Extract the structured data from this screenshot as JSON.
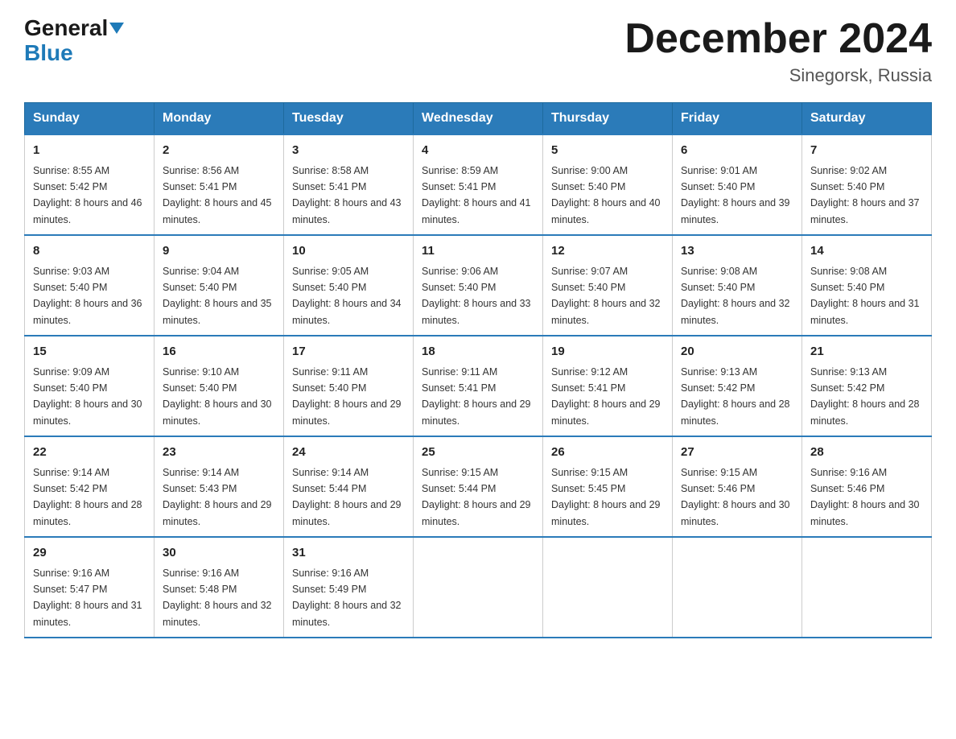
{
  "logo": {
    "general": "General",
    "blue": "Blue"
  },
  "title": "December 2024",
  "location": "Sinegorsk, Russia",
  "header": {
    "days": [
      "Sunday",
      "Monday",
      "Tuesday",
      "Wednesday",
      "Thursday",
      "Friday",
      "Saturday"
    ]
  },
  "weeks": [
    [
      {
        "day": "1",
        "sunrise": "8:55 AM",
        "sunset": "5:42 PM",
        "daylight": "8 hours and 46 minutes."
      },
      {
        "day": "2",
        "sunrise": "8:56 AM",
        "sunset": "5:41 PM",
        "daylight": "8 hours and 45 minutes."
      },
      {
        "day": "3",
        "sunrise": "8:58 AM",
        "sunset": "5:41 PM",
        "daylight": "8 hours and 43 minutes."
      },
      {
        "day": "4",
        "sunrise": "8:59 AM",
        "sunset": "5:41 PM",
        "daylight": "8 hours and 41 minutes."
      },
      {
        "day": "5",
        "sunrise": "9:00 AM",
        "sunset": "5:40 PM",
        "daylight": "8 hours and 40 minutes."
      },
      {
        "day": "6",
        "sunrise": "9:01 AM",
        "sunset": "5:40 PM",
        "daylight": "8 hours and 39 minutes."
      },
      {
        "day": "7",
        "sunrise": "9:02 AM",
        "sunset": "5:40 PM",
        "daylight": "8 hours and 37 minutes."
      }
    ],
    [
      {
        "day": "8",
        "sunrise": "9:03 AM",
        "sunset": "5:40 PM",
        "daylight": "8 hours and 36 minutes."
      },
      {
        "day": "9",
        "sunrise": "9:04 AM",
        "sunset": "5:40 PM",
        "daylight": "8 hours and 35 minutes."
      },
      {
        "day": "10",
        "sunrise": "9:05 AM",
        "sunset": "5:40 PM",
        "daylight": "8 hours and 34 minutes."
      },
      {
        "day": "11",
        "sunrise": "9:06 AM",
        "sunset": "5:40 PM",
        "daylight": "8 hours and 33 minutes."
      },
      {
        "day": "12",
        "sunrise": "9:07 AM",
        "sunset": "5:40 PM",
        "daylight": "8 hours and 32 minutes."
      },
      {
        "day": "13",
        "sunrise": "9:08 AM",
        "sunset": "5:40 PM",
        "daylight": "8 hours and 32 minutes."
      },
      {
        "day": "14",
        "sunrise": "9:08 AM",
        "sunset": "5:40 PM",
        "daylight": "8 hours and 31 minutes."
      }
    ],
    [
      {
        "day": "15",
        "sunrise": "9:09 AM",
        "sunset": "5:40 PM",
        "daylight": "8 hours and 30 minutes."
      },
      {
        "day": "16",
        "sunrise": "9:10 AM",
        "sunset": "5:40 PM",
        "daylight": "8 hours and 30 minutes."
      },
      {
        "day": "17",
        "sunrise": "9:11 AM",
        "sunset": "5:40 PM",
        "daylight": "8 hours and 29 minutes."
      },
      {
        "day": "18",
        "sunrise": "9:11 AM",
        "sunset": "5:41 PM",
        "daylight": "8 hours and 29 minutes."
      },
      {
        "day": "19",
        "sunrise": "9:12 AM",
        "sunset": "5:41 PM",
        "daylight": "8 hours and 29 minutes."
      },
      {
        "day": "20",
        "sunrise": "9:13 AM",
        "sunset": "5:42 PM",
        "daylight": "8 hours and 28 minutes."
      },
      {
        "day": "21",
        "sunrise": "9:13 AM",
        "sunset": "5:42 PM",
        "daylight": "8 hours and 28 minutes."
      }
    ],
    [
      {
        "day": "22",
        "sunrise": "9:14 AM",
        "sunset": "5:42 PM",
        "daylight": "8 hours and 28 minutes."
      },
      {
        "day": "23",
        "sunrise": "9:14 AM",
        "sunset": "5:43 PM",
        "daylight": "8 hours and 29 minutes."
      },
      {
        "day": "24",
        "sunrise": "9:14 AM",
        "sunset": "5:44 PM",
        "daylight": "8 hours and 29 minutes."
      },
      {
        "day": "25",
        "sunrise": "9:15 AM",
        "sunset": "5:44 PM",
        "daylight": "8 hours and 29 minutes."
      },
      {
        "day": "26",
        "sunrise": "9:15 AM",
        "sunset": "5:45 PM",
        "daylight": "8 hours and 29 minutes."
      },
      {
        "day": "27",
        "sunrise": "9:15 AM",
        "sunset": "5:46 PM",
        "daylight": "8 hours and 30 minutes."
      },
      {
        "day": "28",
        "sunrise": "9:16 AM",
        "sunset": "5:46 PM",
        "daylight": "8 hours and 30 minutes."
      }
    ],
    [
      {
        "day": "29",
        "sunrise": "9:16 AM",
        "sunset": "5:47 PM",
        "daylight": "8 hours and 31 minutes."
      },
      {
        "day": "30",
        "sunrise": "9:16 AM",
        "sunset": "5:48 PM",
        "daylight": "8 hours and 32 minutes."
      },
      {
        "day": "31",
        "sunrise": "9:16 AM",
        "sunset": "5:49 PM",
        "daylight": "8 hours and 32 minutes."
      },
      null,
      null,
      null,
      null
    ]
  ]
}
